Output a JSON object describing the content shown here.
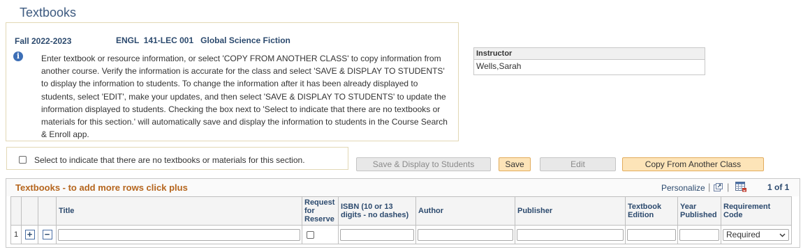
{
  "page": {
    "title": "Textbooks"
  },
  "course": {
    "term": "Fall 2022-2023",
    "section": "ENGL  141-LEC 001   Global Science Fiction",
    "instructions": "Enter textbook or resource information, or select 'COPY FROM ANOTHER CLASS' to copy information from another course. Verify the information is accurate for the class and select 'SAVE & DISPLAY TO STUDENTS' to display the information to students. To change the information after it has been already displayed to students, select 'EDIT', make your updates, and then select 'SAVE & DISPLAY TO STUDENTS' to update the information displayed to students. Checking the box next to 'Select to indicate that there are no textbooks or materials for this section.' will automatically save and display the information to students in the Course Search & Enroll app."
  },
  "instructor": {
    "header": "Instructor",
    "name": "Wells,Sarah"
  },
  "no_textbooks": {
    "label": "Select to indicate that there are no textbooks or materials for this section.",
    "checked": false
  },
  "buttons": {
    "save_display": "Save & Display to Students",
    "save": "Save",
    "edit": "Edit",
    "copy": "Copy From Another Class"
  },
  "grid": {
    "title": "Textbooks - to add more rows click plus",
    "personalize": "Personalize",
    "pipe": "|",
    "pager": "1 of 1",
    "columns": {
      "title": "Title",
      "reserve": "Request for Reserve",
      "isbn": "ISBN (10 or 13 digits - no dashes)",
      "author": "Author",
      "publisher": "Publisher",
      "edition": "Textbook Edition",
      "year": "Year Published",
      "requirement": "Requirement Code"
    },
    "rows": [
      {
        "number": "1",
        "add": "+",
        "remove": "−",
        "requirement": "Required"
      }
    ]
  },
  "icons": {
    "info": "i",
    "dropdown": "⌄"
  },
  "colors": {
    "heading_blue": "#3d5a80",
    "grid_title": "#b5651d",
    "active_button": "#fde4b8"
  }
}
